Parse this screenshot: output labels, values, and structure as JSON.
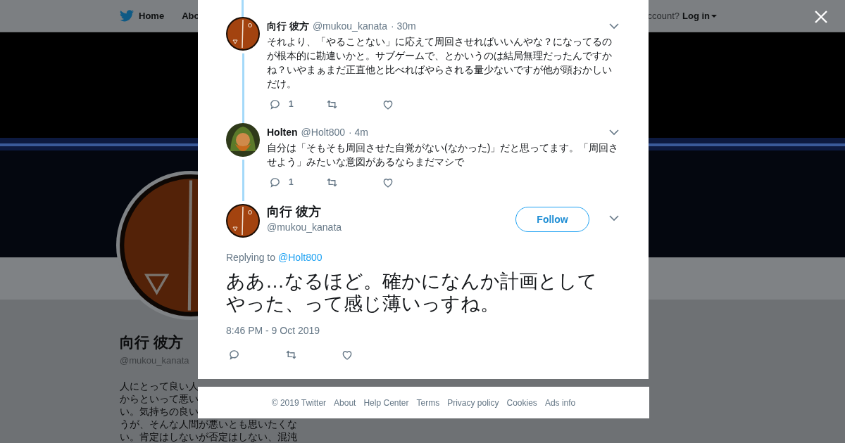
{
  "header": {
    "nav": [
      {
        "label": "Home"
      },
      {
        "label": "Abo"
      }
    ],
    "account_prompt": "ccount?",
    "login": "Log in"
  },
  "profile": {
    "name": "向行 彼方",
    "handle": "@mukou_kanata",
    "bio_lines": [
      "人にとって良い人",
      "からといって悪い",
      "い。気持ちの良い",
      "うが、そんな人間が悪いとも思いたくな",
      "い。肯定はしないが否定はしない、混沌"
    ]
  },
  "thread": [
    {
      "name": "向行 彼方",
      "handle": "@mukou_kanata",
      "time": "· 30m",
      "text": "それより、「やることない」に応えて周回させればいいんやな？になってるのが根本的に勘違いかと。サブゲームで、とかいうのは結局無理だったんですかね？いやまぁまだ正直他と比べればやらされる量少ないですが他が頭おかしいだけ。",
      "replies": "1"
    },
    {
      "name": "Holten",
      "handle": "@Holt800",
      "time": "· 4m",
      "text": "自分は「そもそも周回させた自覚がない(なかった)」だと思ってます。「周回させよう」みたいな意図があるならまだマシで",
      "replies": "1"
    }
  ],
  "tweet": {
    "name": "向行 彼方",
    "handle": "@mukou_kanata",
    "follow": "Follow",
    "replying_label": "Replying to",
    "replying_to": "@Holt800",
    "text": "ああ…なるほど。確かになんか計画としてやった、って感じ薄いっすね。",
    "timestamp": "8:46 PM - 9 Oct 2019"
  },
  "footer": [
    "© 2019 Twitter",
    "About",
    "Help Center",
    "Terms",
    "Privacy policy",
    "Cookies",
    "Ads info"
  ]
}
